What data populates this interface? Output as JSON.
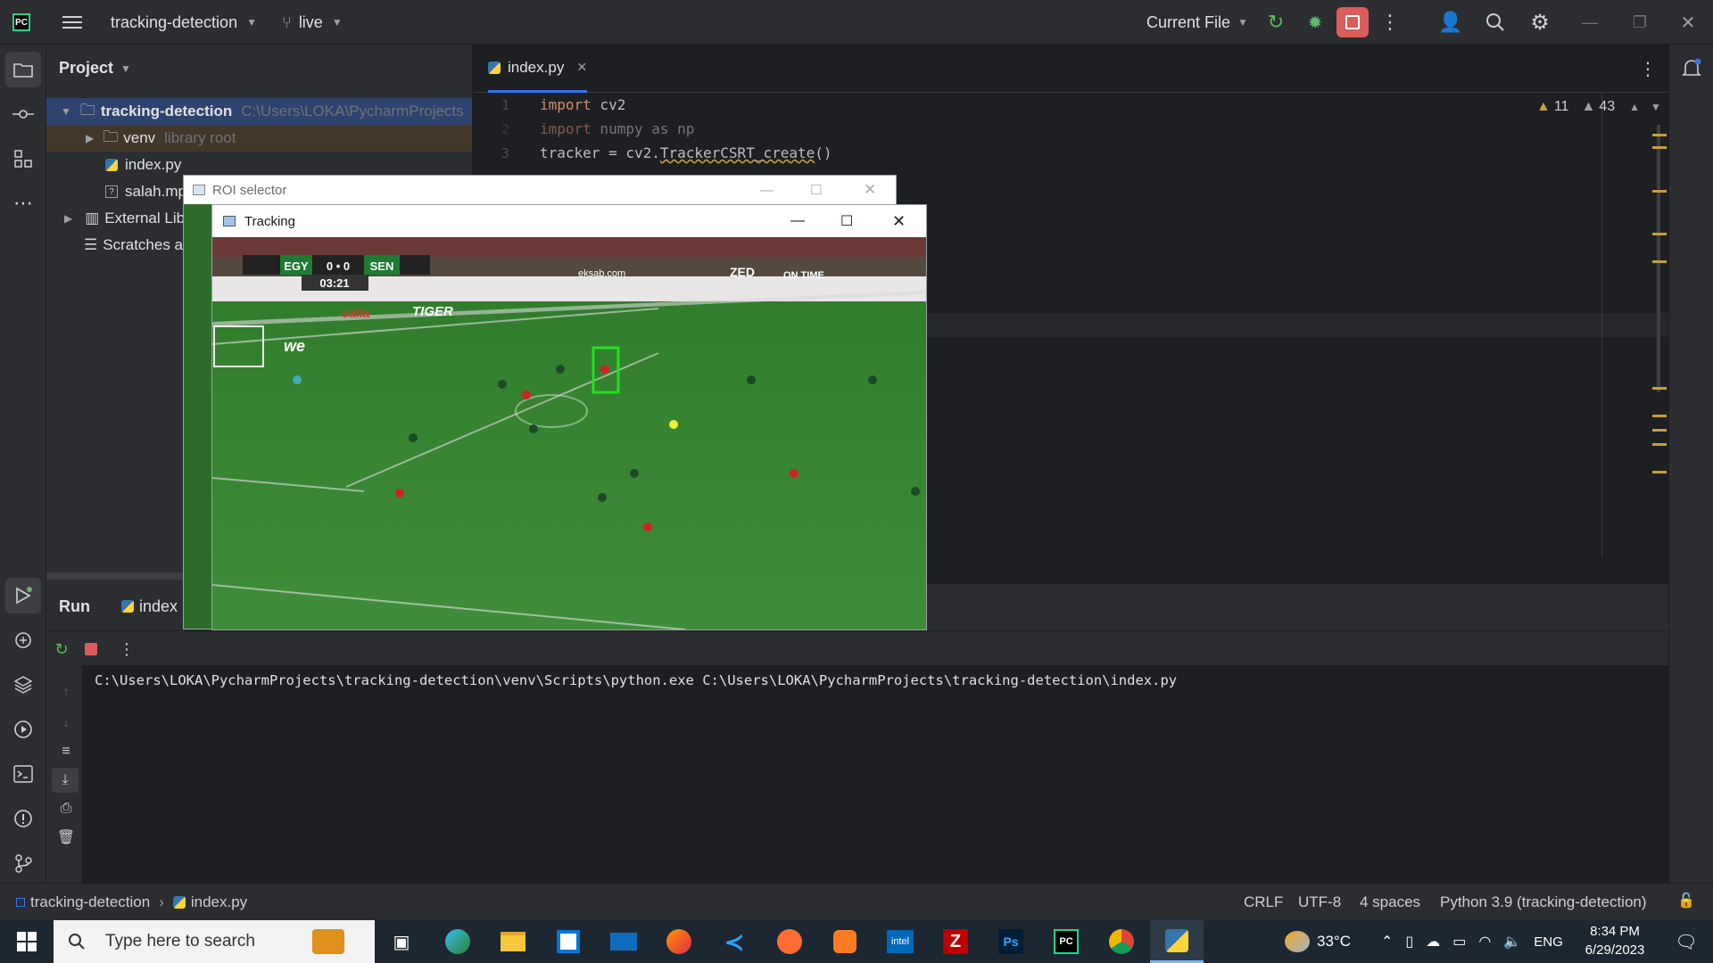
{
  "titlebar": {
    "project": "tracking-detection",
    "branch": "live",
    "run_config": "Current File"
  },
  "project_panel": {
    "title": "Project",
    "tree": [
      {
        "label": "tracking-detection",
        "hint": "C:\\Users\\LOKA\\PycharmProjects"
      },
      {
        "label": "venv",
        "hint": "library root"
      },
      {
        "label": "index.py",
        "hint": ""
      },
      {
        "label": "salah.mp",
        "hint": ""
      },
      {
        "label": "External Lib",
        "hint": ""
      },
      {
        "label": "Scratches a",
        "hint": ""
      }
    ]
  },
  "editor": {
    "tab": "index.py",
    "warnings": "11",
    "weak_warnings": "43",
    "lines": [
      {
        "n": "1",
        "kw": "import",
        "rest": " cv2"
      },
      {
        "n": "2",
        "kw": "import",
        "rest": " numpy as np"
      },
      {
        "n": "3",
        "pre": "tracker = cv2.",
        "fn": "TrackerCSRT_create",
        "post": "()"
      }
    ]
  },
  "roi_window": {
    "title": "ROI selector"
  },
  "tracking_window": {
    "title": "Tracking",
    "scoreboard": {
      "team1": "EGY",
      "score": "0 • 0",
      "team2": "SEN",
      "clock": "03:21"
    },
    "ads": [
      "salla",
      "we",
      "TIGER",
      "eksab.com",
      "ZED",
      "ON TIME"
    ]
  },
  "run_panel": {
    "tab_run": "Run",
    "tab_config": "index",
    "output": "C:\\Users\\LOKA\\PycharmProjects\\tracking-detection\\venv\\Scripts\\python.exe C:\\Users\\LOKA\\PycharmProjects\\tracking-detection\\index.py"
  },
  "statusbar": {
    "crumb_project": "tracking-detection",
    "crumb_file": "index.py",
    "line_sep": "CRLF",
    "encoding": "UTF-8",
    "indent": "4 spaces",
    "interpreter": "Python 3.9 (tracking-detection)"
  },
  "taskbar": {
    "search_placeholder": "Type here to search",
    "temperature": "33°C",
    "lang": "ENG",
    "time": "8:34 PM",
    "date": "6/29/2023",
    "apps": [
      "Edge",
      "File Explorer",
      "Store",
      "Mail",
      "Firefox",
      "VS Code",
      "Postman",
      "XAMPP",
      "Intel",
      "FileZilla",
      "Photoshop",
      "PyCharm",
      "Chrome",
      "Python"
    ]
  },
  "colors": {
    "accent_stop": "#db5c5c",
    "run_green": "#5fb865",
    "tracker_box": "#22e022",
    "pitch": "#3f8d3a"
  }
}
